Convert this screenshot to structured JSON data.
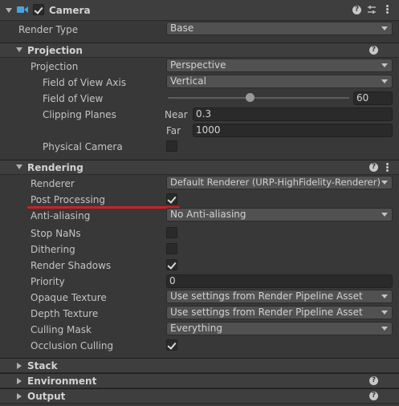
{
  "component": {
    "title": "Camera",
    "enabled": true,
    "icons": [
      "camera-icon",
      "help-icon",
      "presets-icon",
      "kebab-menu-icon"
    ]
  },
  "render_type": {
    "label": "Render Type",
    "value": "Base"
  },
  "projection": {
    "header": "Projection",
    "projection": {
      "label": "Projection",
      "value": "Perspective"
    },
    "fov_axis": {
      "label": "Field of View Axis",
      "value": "Vertical"
    },
    "fov": {
      "label": "Field of View",
      "value": "60",
      "slider_fraction": 0.45
    },
    "clipping": {
      "label": "Clipping Planes",
      "near_label": "Near",
      "near": "0.3",
      "far_label": "Far",
      "far": "1000"
    },
    "physical_camera": {
      "label": "Physical Camera",
      "checked": false
    }
  },
  "rendering": {
    "header": "Rendering",
    "renderer": {
      "label": "Renderer",
      "value": "Default Renderer (URP-HighFidelity-Renderer)"
    },
    "post_processing": {
      "label": "Post Processing",
      "checked": true
    },
    "anti_aliasing": {
      "label": "Anti-aliasing",
      "value": "No Anti-aliasing"
    },
    "stop_nans": {
      "label": "Stop NaNs",
      "checked": false
    },
    "dithering": {
      "label": "Dithering",
      "checked": false
    },
    "render_shadows": {
      "label": "Render Shadows",
      "checked": true
    },
    "priority": {
      "label": "Priority",
      "value": "0"
    },
    "opaque_texture": {
      "label": "Opaque Texture",
      "value": "Use settings from Render Pipeline Asset"
    },
    "depth_texture": {
      "label": "Depth Texture",
      "value": "Use settings from Render Pipeline Asset"
    },
    "culling_mask": {
      "label": "Culling Mask",
      "value": "Everything"
    },
    "occlusion_culling": {
      "label": "Occlusion Culling",
      "checked": true
    }
  },
  "collapsed_sections": {
    "stack": "Stack",
    "environment": "Environment",
    "output": "Output"
  },
  "colors": {
    "background": "#383838",
    "header": "#3e3e3e",
    "field": "#2a2a2a",
    "dropdown": "#515151",
    "annotation_underline": "#d21f1f",
    "camera_icon": "#4aa3df"
  }
}
